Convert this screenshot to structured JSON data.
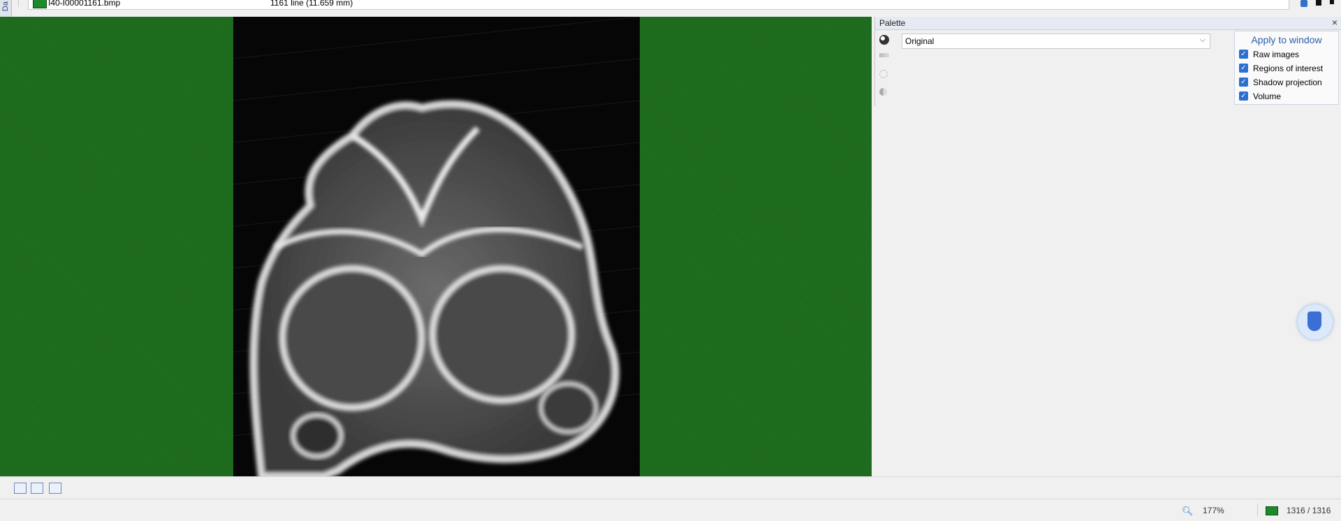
{
  "side_tab": {
    "label": "Da"
  },
  "file_info": {
    "filename": "I40-I00001161.bmp",
    "line_info": "1161 line (11.659 mm)"
  },
  "palette": {
    "title": "Palette",
    "close_label": "×",
    "selected": "Original",
    "apply": {
      "title": "Apply to window",
      "options": [
        {
          "label": "Raw images",
          "checked": true
        },
        {
          "label": "Regions of interest",
          "checked": true
        },
        {
          "label": "Shadow projection",
          "checked": true
        },
        {
          "label": "Volume",
          "checked": true
        }
      ]
    }
  },
  "status": {
    "zoom": "177%",
    "frame": "1316 / 1316"
  },
  "icons": {
    "palette_tools": [
      "color-wheel-icon",
      "gradient-icon",
      "brightness-icon",
      "contrast-icon"
    ],
    "bottom_toolbar": [
      "window-icon",
      "fullscreen-icon",
      "zoom-window-icon"
    ]
  },
  "colors": {
    "viewer_background": "#1f6e1f",
    "accent": "#2a6fd1",
    "apply_title": "#2a5ea8"
  }
}
